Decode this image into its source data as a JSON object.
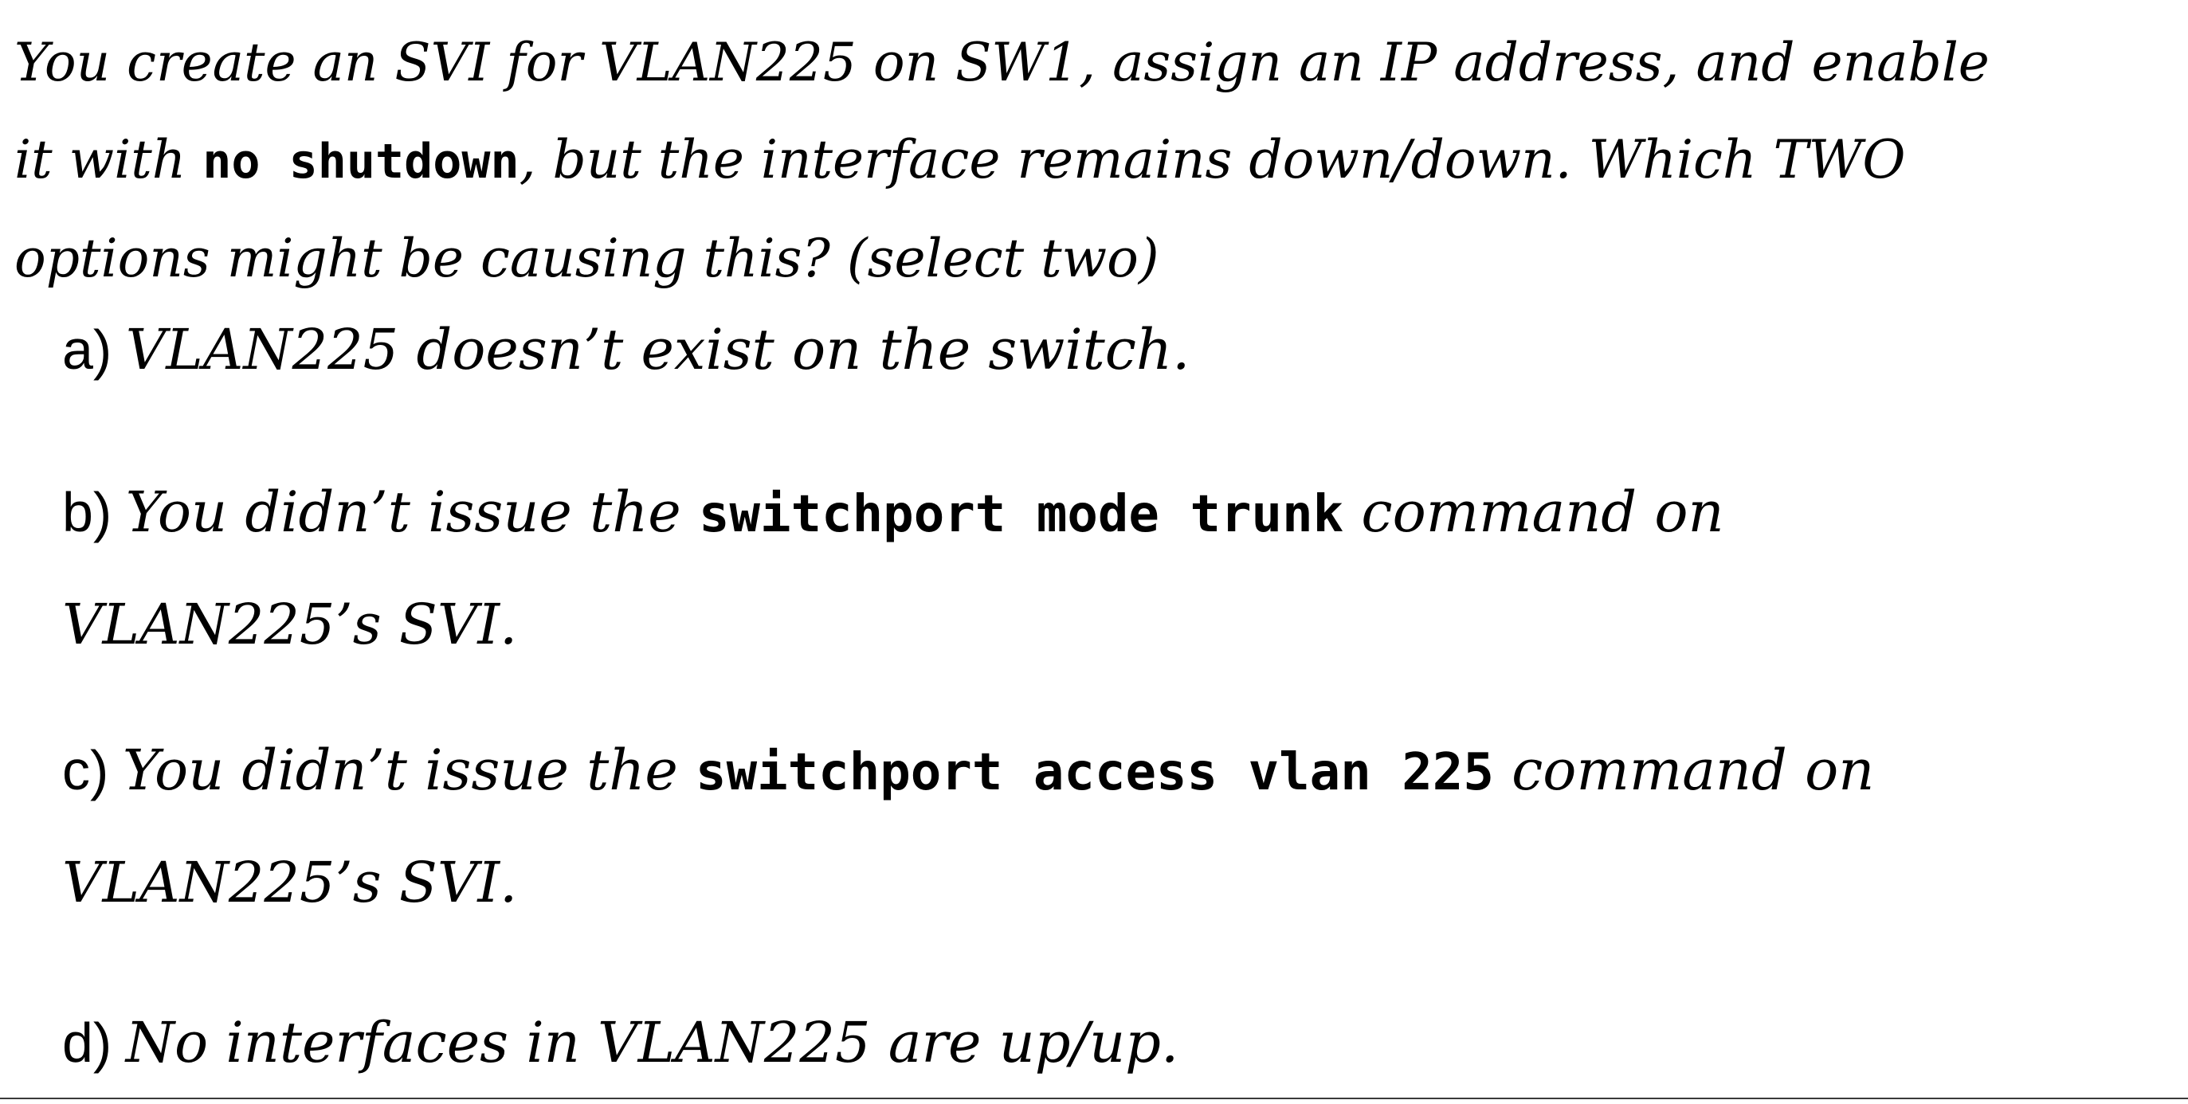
{
  "question": {
    "part1": "You create an SVI for VLAN225 on SW1, assign an IP address, and enable",
    "part2": "it with ",
    "cmd": "no shutdown",
    "part3": ", but the interface remains down/down.  Which TWO",
    "part4": "options might be causing this?  (select two)"
  },
  "options": {
    "a": {
      "letter": "a)",
      "text": "VLAN225 doesn’t exist on the switch."
    },
    "b": {
      "letter": "b)",
      "pre": "You didn’t issue the ",
      "cmd": "switchport mode trunk",
      "post": " command on",
      "line2": "VLAN225’s SVI."
    },
    "c": {
      "letter": "c)",
      "pre": "You didn’t issue the ",
      "cmd": "switchport access vlan 225",
      "post": " command on",
      "line2": "VLAN225’s SVI."
    },
    "d": {
      "letter": "d)",
      "text": "No interfaces in VLAN225 are up/up."
    }
  }
}
